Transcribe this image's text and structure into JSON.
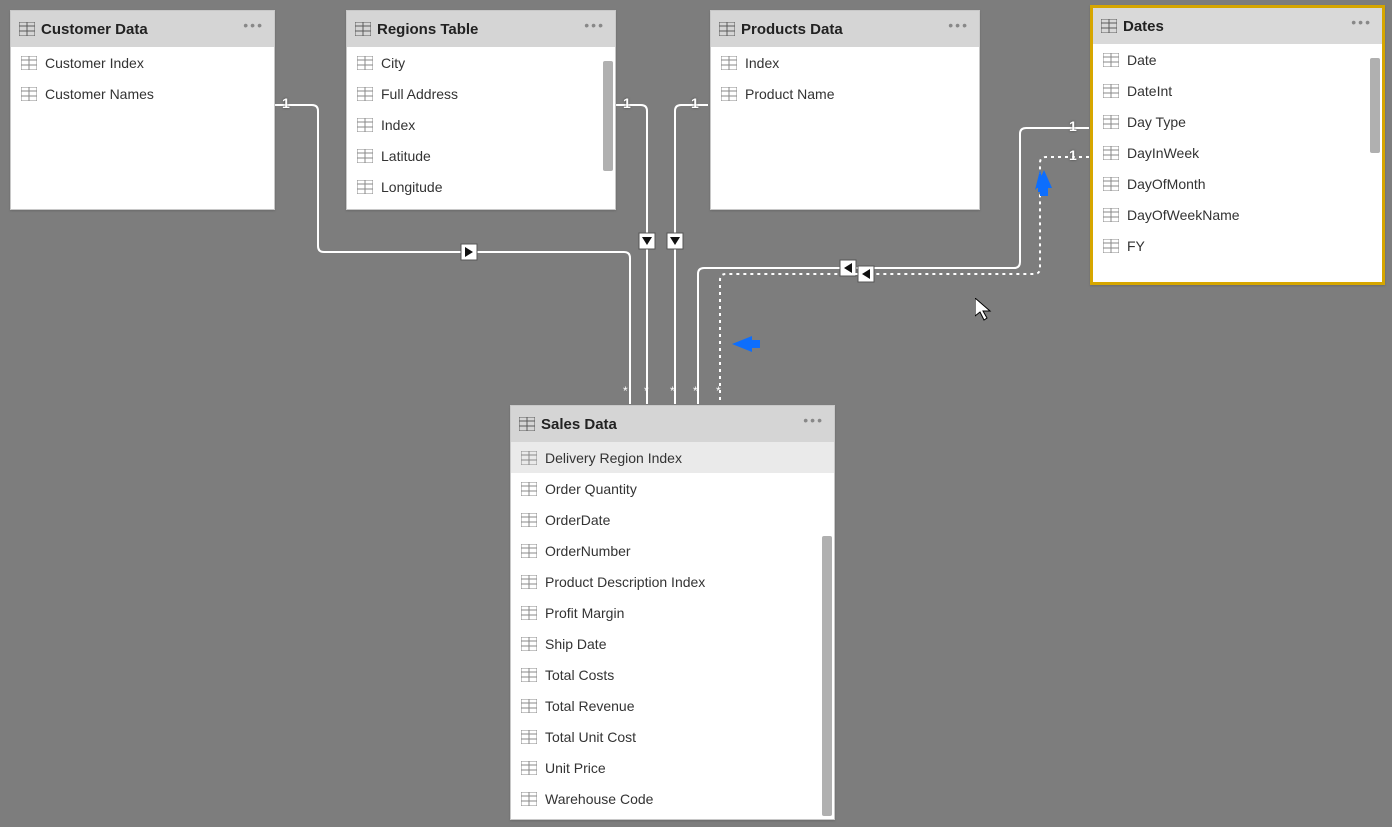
{
  "tables": {
    "customer": {
      "title": "Customer Data",
      "fields": [
        "Customer Index",
        "Customer Names"
      ]
    },
    "regions": {
      "title": "Regions Table",
      "fields": [
        "City",
        "Full Address",
        "Index",
        "Latitude",
        "Longitude"
      ]
    },
    "products": {
      "title": "Products Data",
      "fields": [
        "Index",
        "Product Name"
      ]
    },
    "dates": {
      "title": "Dates",
      "fields": [
        "Date",
        "DateInt",
        "Day Type",
        "DayInWeek",
        "DayOfMonth",
        "DayOfWeekName",
        "FY"
      ]
    },
    "sales": {
      "title": "Sales Data",
      "fields": [
        "Delivery Region Index",
        "Order Quantity",
        "OrderDate",
        "OrderNumber",
        "Product Description Index",
        "Profit Margin",
        "Ship Date",
        "Total Costs",
        "Total Revenue",
        "Total Unit Cost",
        "Unit Price",
        "Warehouse Code"
      ]
    }
  },
  "cardinality": {
    "one": "1",
    "many": "*"
  }
}
